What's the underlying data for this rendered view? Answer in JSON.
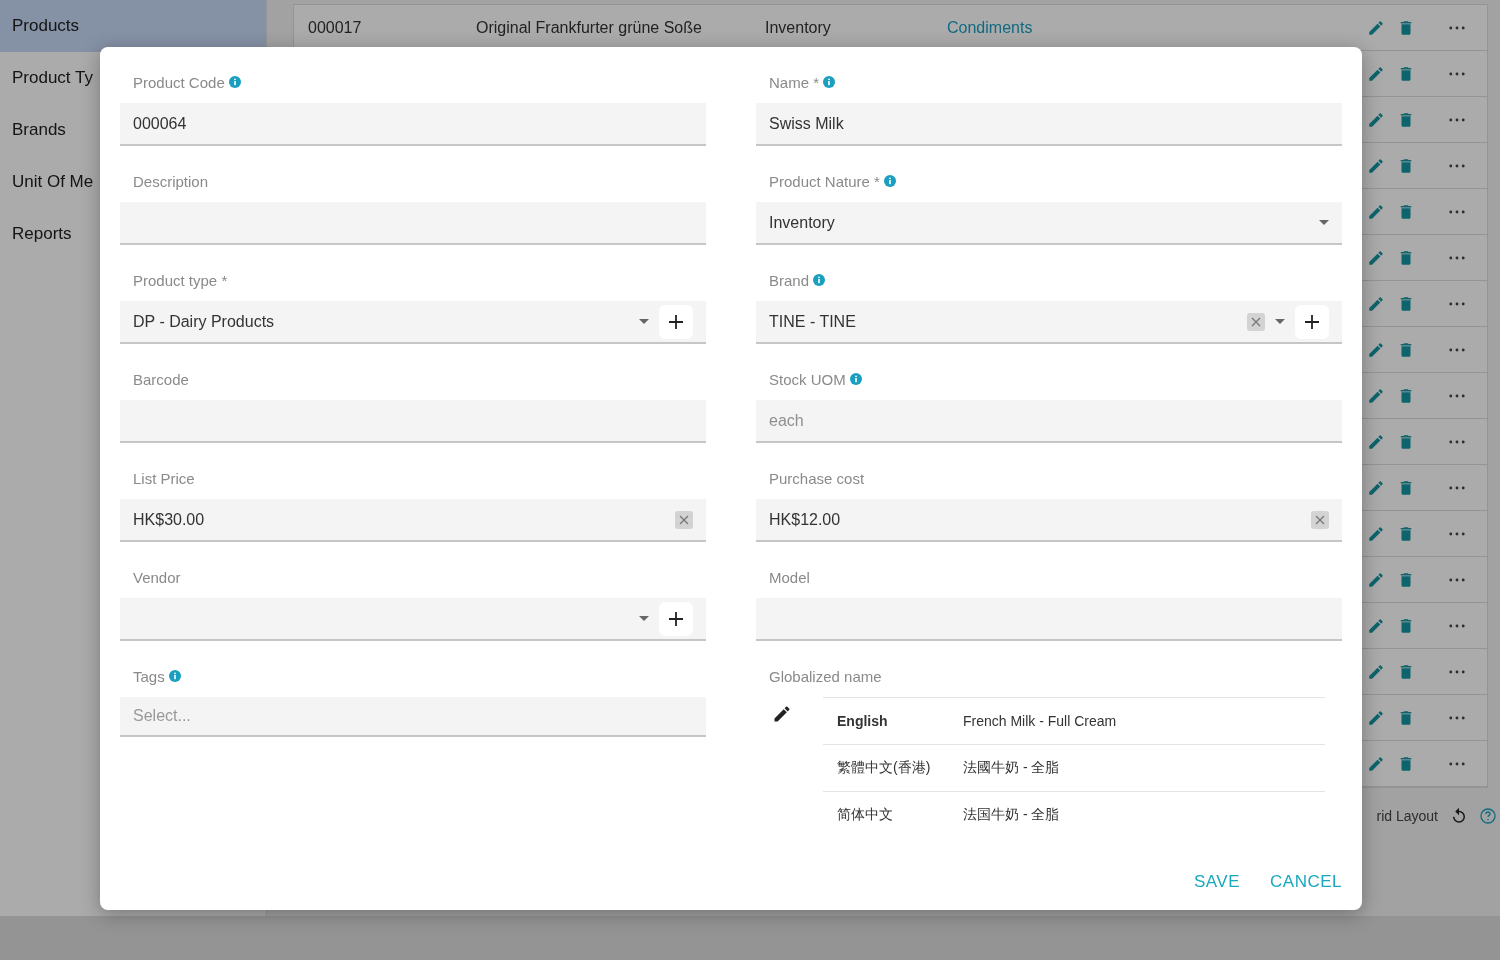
{
  "sidebar": {
    "items": [
      {
        "label": "Products",
        "selected": true
      },
      {
        "label": "Product Ty",
        "selected": false
      },
      {
        "label": "Brands",
        "selected": false
      },
      {
        "label": "Unit Of Me",
        "selected": false
      },
      {
        "label": "Reports",
        "selected": false
      }
    ]
  },
  "table": {
    "rows": [
      {
        "cells": [
          "000017",
          "Original Frankfurter grüne Soße",
          "Inventory",
          "Condiments"
        ]
      },
      {},
      {},
      {},
      {},
      {},
      {},
      {},
      {},
      {},
      {},
      {},
      {},
      {},
      {},
      {},
      {}
    ]
  },
  "footer": {
    "layout_label": "rid Layout"
  },
  "dialog": {
    "columns": [
      {
        "fields": [
          {
            "kind": "text",
            "label": "Product Code",
            "info": true,
            "value": "000064"
          },
          {
            "kind": "text",
            "label": "Description",
            "info": false
          },
          {
            "kind": "select",
            "label": "Product type *",
            "info": false,
            "value": "DP - Dairy Products",
            "clearable": false,
            "addable": true
          },
          {
            "kind": "text",
            "label": "Barcode",
            "info": false
          },
          {
            "kind": "text",
            "label": "List Price",
            "info": false,
            "value": "HK$30.00",
            "clearable": true
          },
          {
            "kind": "select",
            "label": "Vendor",
            "info": false,
            "clearable": false,
            "addable": true
          },
          {
            "kind": "tags",
            "label": "Tags",
            "info": true,
            "placeholder": "Select..."
          }
        ]
      },
      {
        "fields": [
          {
            "kind": "text",
            "label": "Name *",
            "info": true,
            "value": "Swiss Milk"
          },
          {
            "kind": "select",
            "label": "Product Nature *",
            "info": true,
            "value": "Inventory",
            "clearable": false,
            "addable": false
          },
          {
            "kind": "select",
            "label": "Brand",
            "info": true,
            "value": "TINE - TINE",
            "clearable": true,
            "addable": true
          },
          {
            "kind": "text",
            "label": "Stock UOM",
            "info": true,
            "value": "each",
            "disabled": true
          },
          {
            "kind": "text",
            "label": "Purchase cost",
            "info": false,
            "value": "HK$12.00",
            "clearable": true
          },
          {
            "kind": "text",
            "label": "Model",
            "info": false
          },
          {
            "kind": "translations",
            "label": "Globalized name",
            "info": false,
            "rows": [
              {
                "language": "English",
                "name": "French Milk - Full Cream",
                "default": true
              },
              {
                "language": "繁體中文(香港)",
                "name": "法國牛奶 - 全脂",
                "default": false
              },
              {
                "language": "简体中文",
                "name": "法国牛奶 - 全脂",
                "default": false
              }
            ]
          }
        ]
      }
    ],
    "buttons": [
      "SAVE",
      "CANCEL"
    ]
  }
}
